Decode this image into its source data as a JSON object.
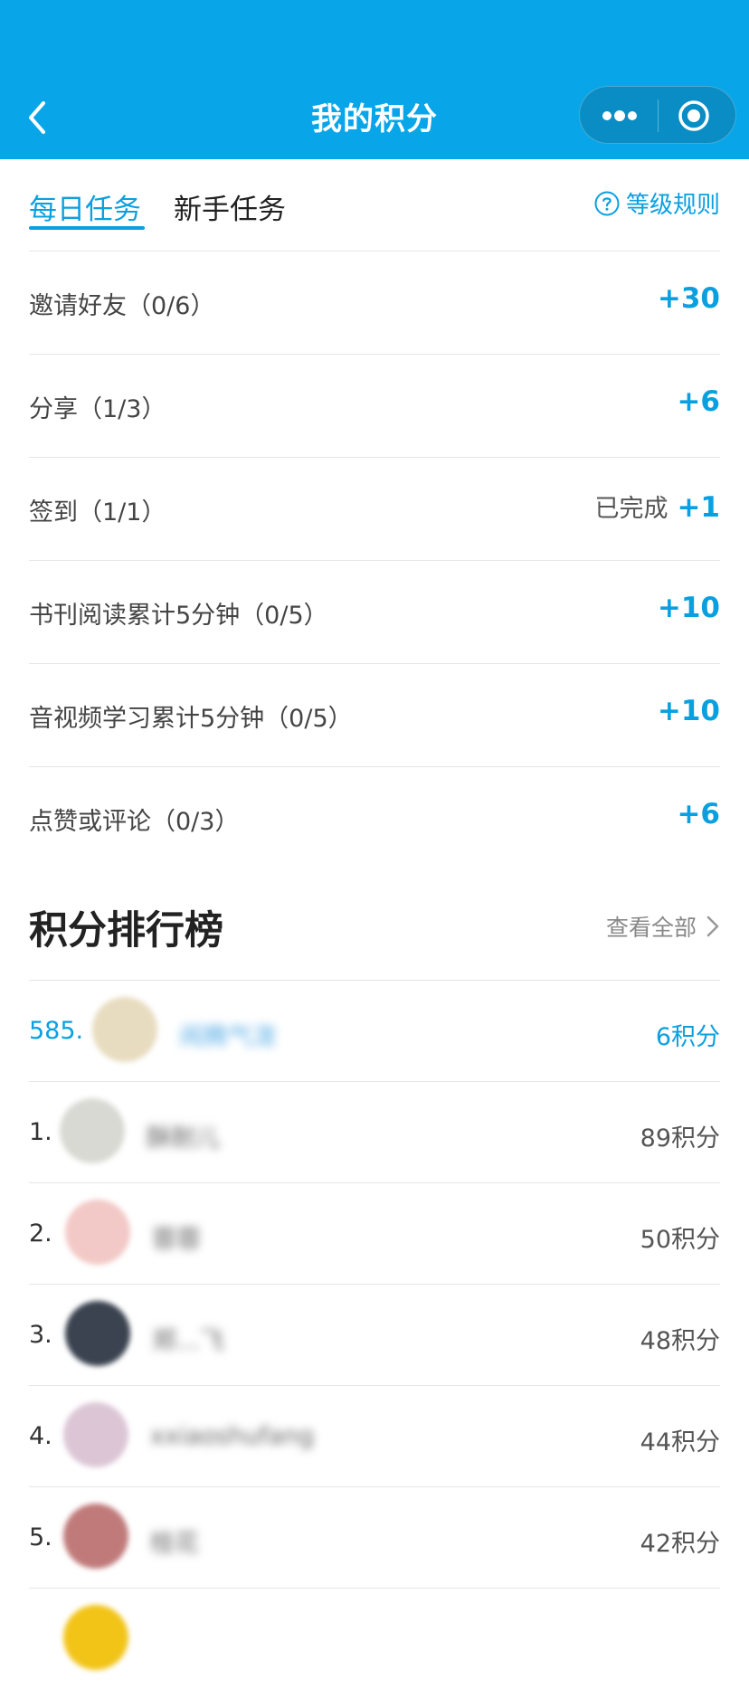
{
  "header": {
    "title": "我的积分"
  },
  "tabs": {
    "daily": "每日任务",
    "newbie": "新手任务",
    "rules": "等级规则"
  },
  "tasks": [
    {
      "name": "邀请好友（0/6）",
      "status": "",
      "points": "+30"
    },
    {
      "name": "分享（1/3）",
      "status": "",
      "points": "+6"
    },
    {
      "name": "签到（1/1）",
      "status": "已完成",
      "points": "+1"
    },
    {
      "name": "书刊阅读累计5分钟（0/5）",
      "status": "",
      "points": "+10"
    },
    {
      "name": "音视频学习累计5分钟（0/5）",
      "status": "",
      "points": "+10"
    },
    {
      "name": "点赞或评论（0/3）",
      "status": "",
      "points": "+6"
    }
  ],
  "ranking": {
    "title": "积分排行榜",
    "view_all": "查看全部",
    "me": {
      "rank": "585.",
      "name": "闹腾气泼",
      "score": "6积分",
      "avatar_color": "#e8dcc0"
    },
    "rows": [
      {
        "rank": "1.",
        "name": "酥耐儿",
        "score": "89积分",
        "avatar_color": "#d9d9d4"
      },
      {
        "rank": "2.",
        "name": "蓉蓉",
        "score": "50积分",
        "avatar_color": "#f2c9c6"
      },
      {
        "rank": "3.",
        "name": "郑...飞",
        "score": "48积分",
        "avatar_color": "#3b4350"
      },
      {
        "rank": "4.",
        "name": "xxiaoshufang",
        "score": "44积分",
        "avatar_color": "#dcc6d6"
      },
      {
        "rank": "5.",
        "name": "桂花",
        "score": "42积分",
        "avatar_color": "#c07a7a"
      }
    ]
  },
  "colors": {
    "primary": "#08a6e8",
    "accent_text": "#0aa0e0"
  }
}
